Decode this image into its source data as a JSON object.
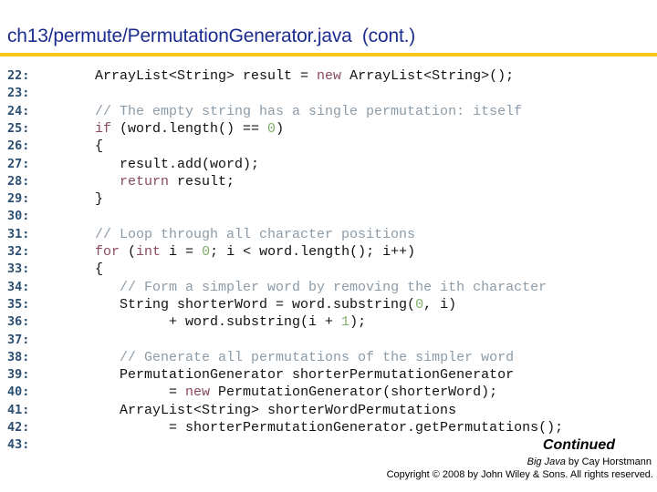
{
  "header": {
    "title": "ch13/permute/PermutationGenerator.java  (cont.)"
  },
  "colors": {
    "title": "#1c2d8f",
    "rule": "#f5c518",
    "line_number": "#2a4f73",
    "keyword": "#8a4a60",
    "comment": "#8c9ba8",
    "number": "#7fae6a",
    "text": "#111111"
  },
  "code": {
    "lines": [
      {
        "num": "22:",
        "tokens": [
          {
            "t": "tx",
            "v": "ArrayList<String> result = "
          },
          {
            "t": "kw",
            "v": "new"
          },
          {
            "t": "tx",
            "v": " ArrayList<String>();"
          }
        ]
      },
      {
        "num": "23:",
        "tokens": []
      },
      {
        "num": "24:",
        "tokens": [
          {
            "t": "cm",
            "v": "// The empty string has a single permutation: itself"
          }
        ]
      },
      {
        "num": "25:",
        "tokens": [
          {
            "t": "kw",
            "v": "if"
          },
          {
            "t": "tx",
            "v": " (word.length() == "
          },
          {
            "t": "num",
            "v": "0"
          },
          {
            "t": "tx",
            "v": ")"
          }
        ]
      },
      {
        "num": "26:",
        "tokens": [
          {
            "t": "tx",
            "v": "{"
          }
        ]
      },
      {
        "num": "27:",
        "tokens": [
          {
            "t": "tx",
            "v": "   result.add(word);"
          }
        ]
      },
      {
        "num": "28:",
        "tokens": [
          {
            "t": "tx",
            "v": "   "
          },
          {
            "t": "kw",
            "v": "return"
          },
          {
            "t": "tx",
            "v": " result;"
          }
        ]
      },
      {
        "num": "29:",
        "tokens": [
          {
            "t": "tx",
            "v": "}"
          }
        ]
      },
      {
        "num": "30:",
        "tokens": []
      },
      {
        "num": "31:",
        "tokens": [
          {
            "t": "cm",
            "v": "// Loop through all character positions"
          }
        ]
      },
      {
        "num": "32:",
        "tokens": [
          {
            "t": "kw",
            "v": "for"
          },
          {
            "t": "tx",
            "v": " ("
          },
          {
            "t": "kw",
            "v": "int"
          },
          {
            "t": "tx",
            "v": " i = "
          },
          {
            "t": "num",
            "v": "0"
          },
          {
            "t": "tx",
            "v": "; i < word.length(); i++)"
          }
        ]
      },
      {
        "num": "33:",
        "tokens": [
          {
            "t": "tx",
            "v": "{"
          }
        ]
      },
      {
        "num": "34:",
        "tokens": [
          {
            "t": "tx",
            "v": "   "
          },
          {
            "t": "cm",
            "v": "// Form a simpler word by removing the ith character"
          }
        ]
      },
      {
        "num": "35:",
        "tokens": [
          {
            "t": "tx",
            "v": "   String shorterWord = word.substring("
          },
          {
            "t": "num",
            "v": "0"
          },
          {
            "t": "tx",
            "v": ", i)"
          }
        ]
      },
      {
        "num": "36:",
        "tokens": [
          {
            "t": "tx",
            "v": "         + word.substring(i + "
          },
          {
            "t": "num",
            "v": "1"
          },
          {
            "t": "tx",
            "v": ");"
          }
        ]
      },
      {
        "num": "37:",
        "tokens": []
      },
      {
        "num": "38:",
        "tokens": [
          {
            "t": "tx",
            "v": "   "
          },
          {
            "t": "cm",
            "v": "// Generate all permutations of the simpler word"
          }
        ]
      },
      {
        "num": "39:",
        "tokens": [
          {
            "t": "tx",
            "v": "   PermutationGenerator shorterPermutationGenerator"
          }
        ]
      },
      {
        "num": "40:",
        "tokens": [
          {
            "t": "tx",
            "v": "         = "
          },
          {
            "t": "kw",
            "v": "new"
          },
          {
            "t": "tx",
            "v": " PermutationGenerator(shorterWord);"
          }
        ]
      },
      {
        "num": "41:",
        "tokens": [
          {
            "t": "tx",
            "v": "   ArrayList<String> shorterWordPermutations"
          }
        ]
      },
      {
        "num": "42:",
        "tokens": [
          {
            "t": "tx",
            "v": "         = shorterPermutationGenerator.getPermutations();"
          }
        ]
      },
      {
        "num": "43:",
        "tokens": []
      }
    ]
  },
  "footer": {
    "continued": "Continued",
    "book_title": "Big Java",
    "book_author": " by Cay Horstmann",
    "copyright": "Copyright © 2008 by John Wiley & Sons.  All rights reserved."
  }
}
